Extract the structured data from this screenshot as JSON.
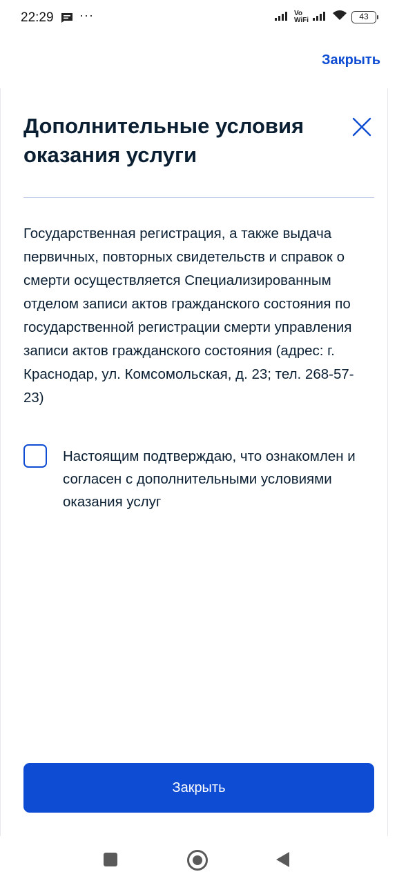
{
  "status_bar": {
    "time": "22:29",
    "more": "···",
    "vowifi_top": "Vo",
    "vowifi_bottom": "WiFi",
    "battery": "43"
  },
  "header": {
    "close_link": "Закрыть"
  },
  "sheet": {
    "title": "Дополнительные условия оказания услуги",
    "body": "Государственная регистрация, а также выдача первичных, повторных свидетельств и справок о смерти осуществляется Специализированным отделом записи актов гражданского состояния по государственной регистрации смерти управления записи актов гражданского состояния (адрес: г. Краснодар, ул. Комсомольская, д. 23; тел. 268-57-23)",
    "checkbox_label": "Настоящим подтверждаю, что ознакомлен и согласен с дополнительными условиями оказания услуг",
    "checkbox_checked": false,
    "close_button": "Закрыть"
  },
  "colors": {
    "accent": "#0d4cd3",
    "text": "#0b1f33",
    "divider": "#b8c8e6"
  }
}
